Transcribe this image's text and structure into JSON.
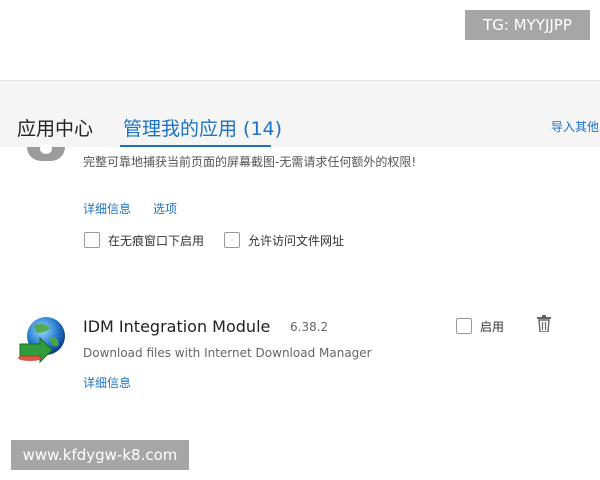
{
  "watermarks": {
    "top": "TG: MYYJJPP",
    "bottom": "www.kfdygw-k8.com"
  },
  "tabs": {
    "apps": "应用中心",
    "manage": "管理我的应用 (14)",
    "import": "导入其他"
  },
  "extension1": {
    "description": "完整可靠地捕获当前页面的屏幕截图-无需请求任何额外的权限!",
    "details_link": "详细信息",
    "options_link": "选项",
    "incognito_label": "在无痕窗口下启用",
    "file_url_label": "允许访问文件网址"
  },
  "extension2": {
    "name": "IDM Integration Module",
    "version": "6.38.2",
    "description": "Download files with Internet Download Manager",
    "details_link": "详细信息",
    "enable_label": "启用"
  },
  "colors": {
    "accent": "#1a73c6",
    "panel_bg": "#f5f5f5",
    "watermark_bg": "#a6a6a6"
  }
}
